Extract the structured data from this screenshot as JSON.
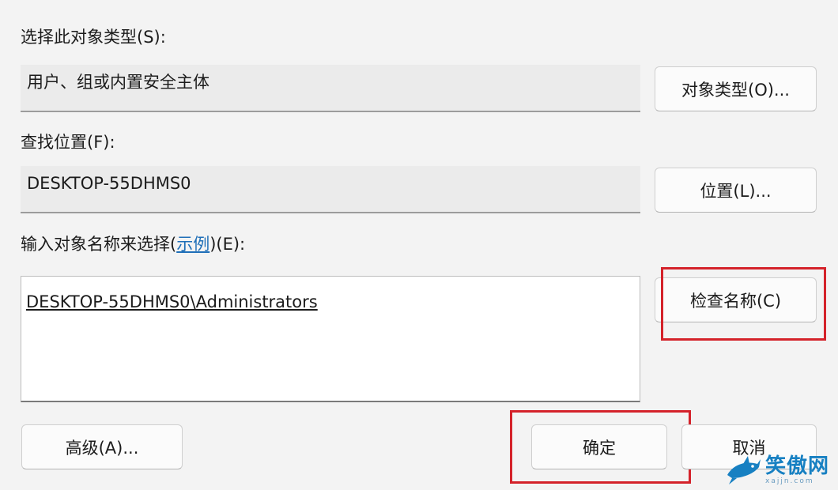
{
  "object_type": {
    "label": "选择此对象类型(S):",
    "value": "用户、组或内置安全主体",
    "button": "对象类型(O)..."
  },
  "location": {
    "label": "查找位置(F):",
    "value": "DESKTOP-55DHMS0",
    "button": "位置(L)..."
  },
  "object_names": {
    "label_before": "输入对象名称来选择(",
    "link": "示例",
    "label_after": ")(E):",
    "value": "DESKTOP-55DHMS0\\Administrators",
    "check_button": "检查名称(C)"
  },
  "footer": {
    "advanced": "高级(A)...",
    "ok": "确定",
    "cancel": "取消"
  },
  "highlight_color": "#d4222a",
  "watermark": {
    "text": "笑傲网",
    "subtext": "xajjn.com"
  }
}
